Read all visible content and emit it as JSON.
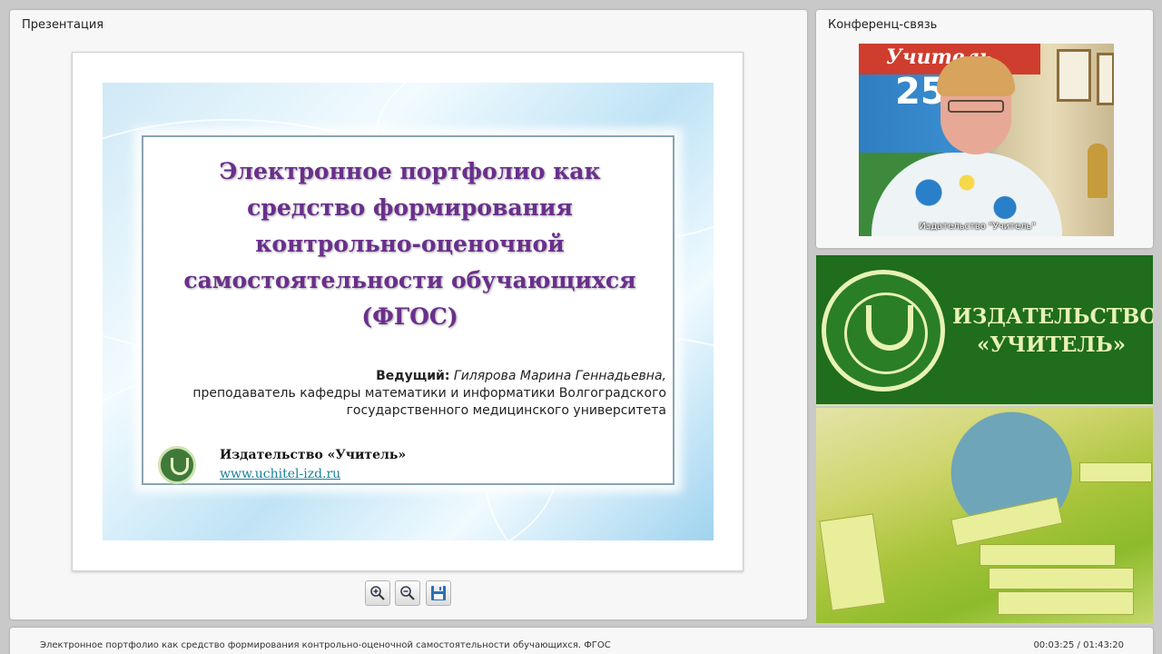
{
  "presentation_panel": {
    "title": "Презентация",
    "slide": {
      "title": "Электронное портфолио как\nсредство формирования\nконтрольно-оценочной\nсамостоятельности обучающихся\n(ФГОС)",
      "presenter_label": "Ведущий:",
      "presenter_name": "Гилярова Марина Геннадьевна,",
      "presenter_line2": "преподаватель кафедры математики и информатики Волгоградского",
      "presenter_line3": "государственного медицинского университета",
      "publisher_name": "Издательство «Учитель»",
      "publisher_url": "www.uchitel-izd.ru"
    },
    "toolbar": {
      "zoom_in_icon": "zoom-in-icon",
      "zoom_out_icon": "zoom-out-icon",
      "save_icon": "floppy-disk-icon"
    }
  },
  "conference_panel": {
    "title": "Конференц-связь",
    "video_caption": "Издательство \"Учитель\"",
    "poster_text": "Учитель",
    "poster_number": "25"
  },
  "banner": {
    "name": "ИЗДАТЕЛЬСТВО\n«УЧИТЕЛЬ»"
  },
  "bottom_bar": {
    "title": "Электронное портфолио как средство формирования контрольно-оценочной самостоятельности обучающихся. ФГОС",
    "time": "00:03:25 / 01:43:20"
  },
  "colors": {
    "slide_title": "#6a2f8c",
    "banner_green": "#1f6d1d",
    "link": "#1b7f9a"
  }
}
